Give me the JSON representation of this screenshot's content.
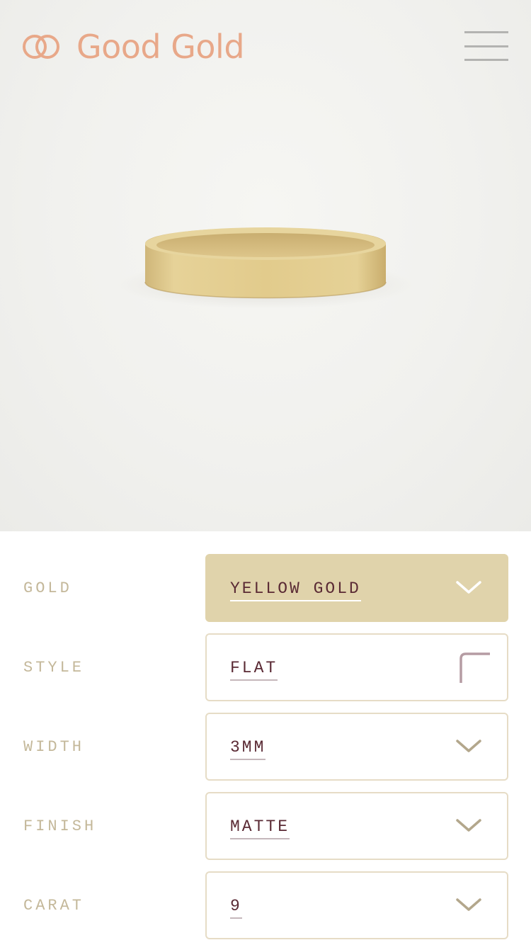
{
  "header": {
    "brand_name": "Good Gold",
    "logo_icon": "interlocking-rings-logo",
    "menu_icon": "hamburger-menu-icon",
    "brand_color": "#e8a889"
  },
  "product": {
    "image_subject": "yellow-gold-flat-matte-ring"
  },
  "options": [
    {
      "label": "GOLD",
      "value": "YELLOW GOLD",
      "icon": "chevron-down-icon",
      "highlighted": true
    },
    {
      "label": "STYLE",
      "value": "FLAT",
      "icon": "corner-icon"
    },
    {
      "label": "WIDTH",
      "value": "3MM",
      "icon": "chevron-down-icon"
    },
    {
      "label": "FINISH",
      "value": "MATTE",
      "icon": "chevron-down-icon"
    },
    {
      "label": "CARAT",
      "value": "9",
      "icon": "chevron-down-icon"
    }
  ],
  "colors": {
    "option_label": "#c4b89a",
    "option_value": "#5a2a34",
    "highlight_fill": "#e0d3ab",
    "box_border": "#e6dcc6"
  }
}
